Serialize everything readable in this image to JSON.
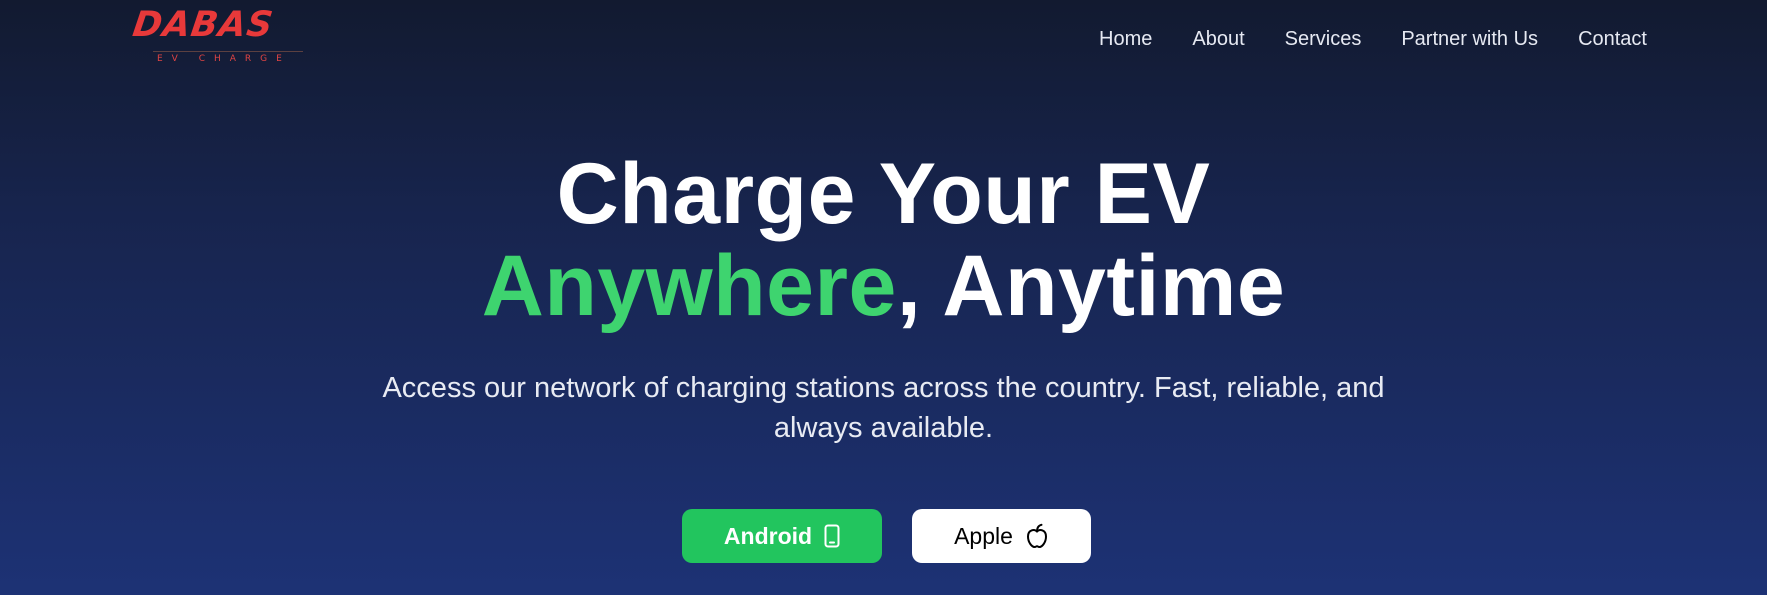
{
  "brand": {
    "name": "DABAS",
    "tagline": "EV CHARGE",
    "color": "#e8393a"
  },
  "nav": {
    "items": [
      {
        "label": "Home"
      },
      {
        "label": "About"
      },
      {
        "label": "Services"
      },
      {
        "label": "Partner with Us"
      },
      {
        "label": "Contact"
      }
    ]
  },
  "hero": {
    "title_line1": "Charge Your EV",
    "title_accent": "Anywhere",
    "title_rest": ", Anytime",
    "accent_color": "#3ed46f",
    "subtitle_line1": "Access our network of charging stations across the country. Fast, reliable, and",
    "subtitle_line2": "always available."
  },
  "buttons": {
    "android": {
      "label": "Android",
      "icon": "smartphone-icon",
      "color": "#22c55e"
    },
    "apple": {
      "label": "Apple",
      "icon": "apple-icon",
      "color": "#ffffff"
    }
  }
}
